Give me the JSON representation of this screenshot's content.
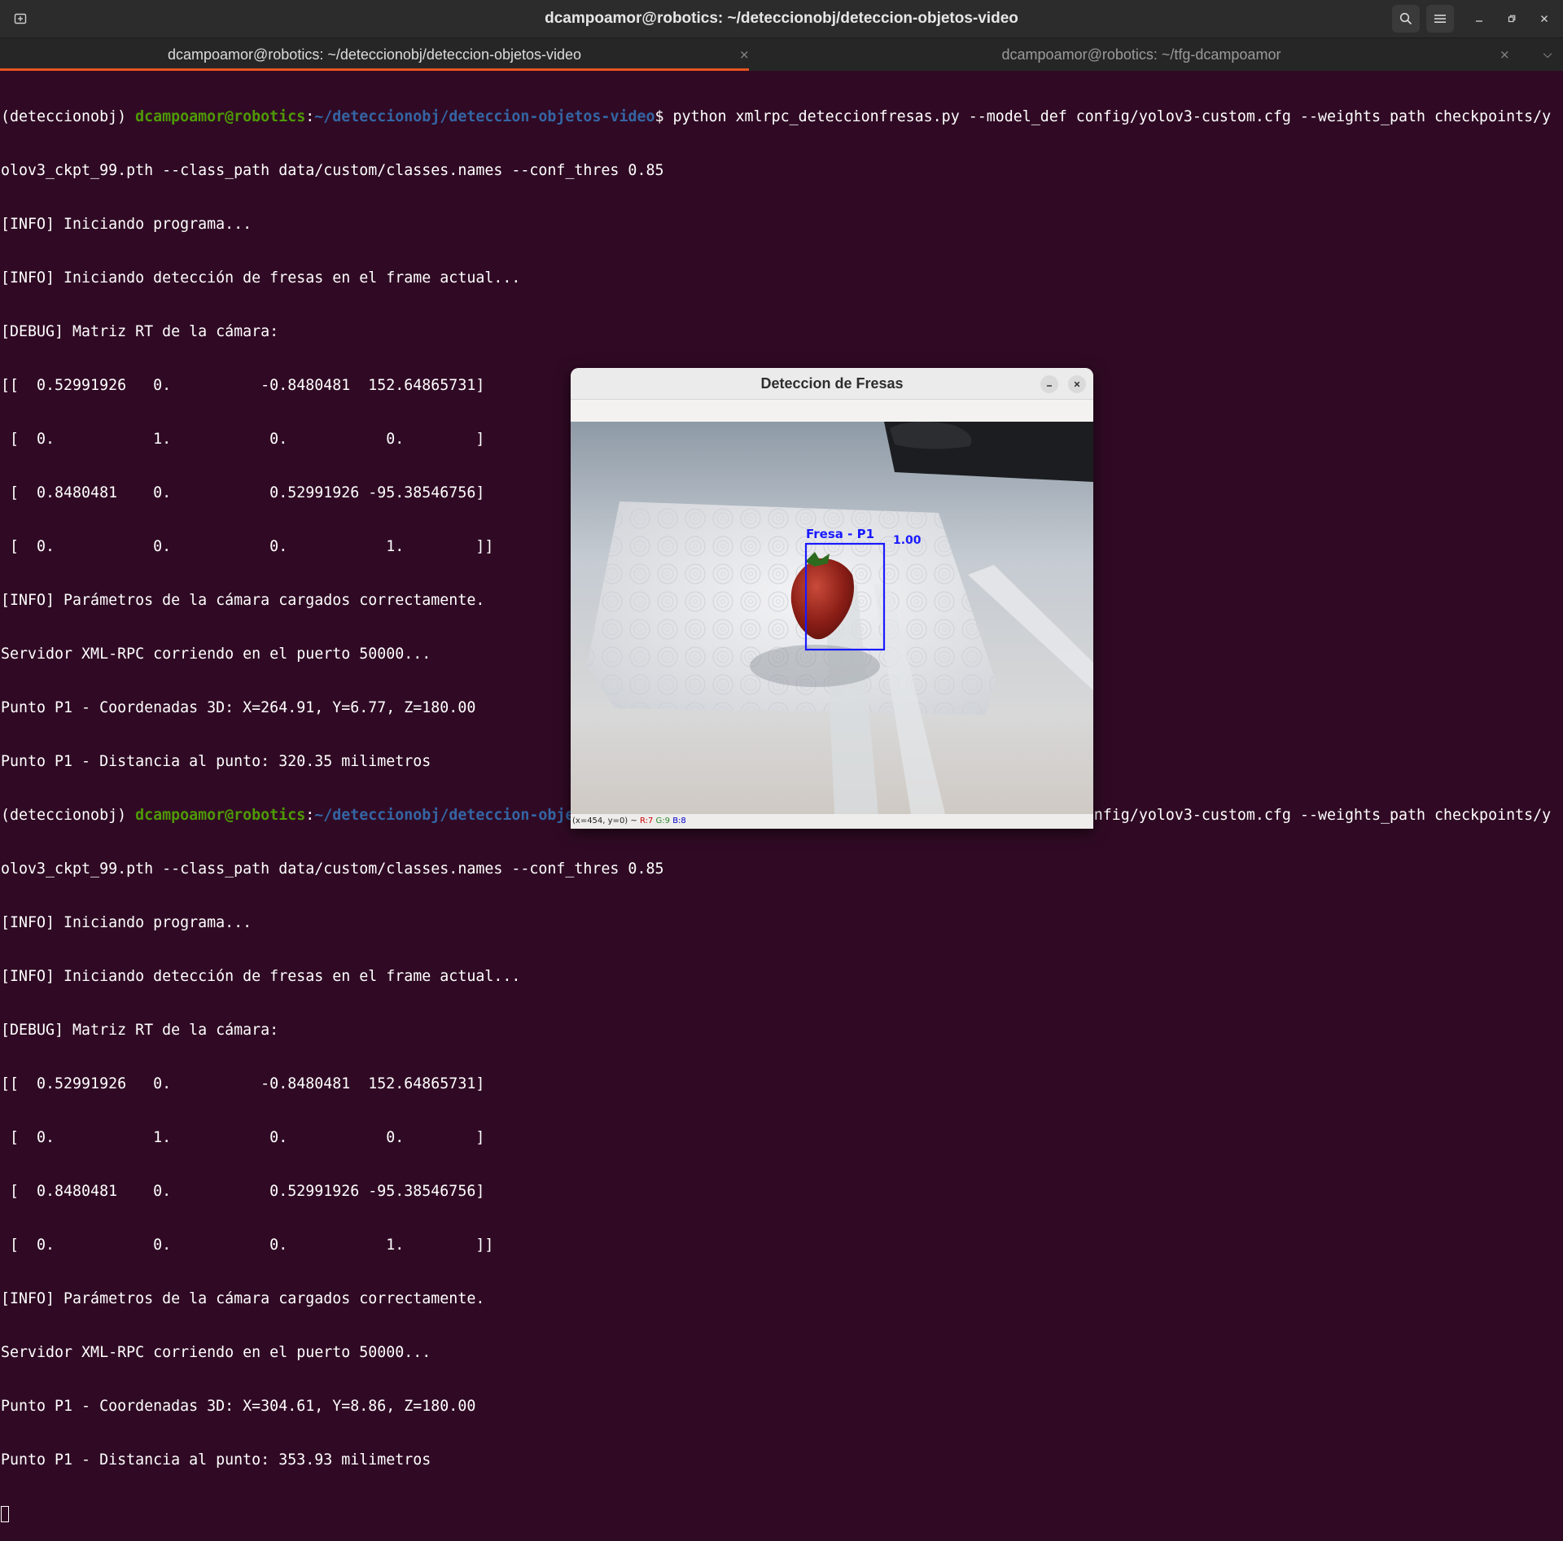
{
  "window": {
    "title": "dcampoamor@robotics: ~/deteccionobj/deteccion-objetos-video"
  },
  "tabs": [
    {
      "label": "dcampoamor@robotics: ~/deteccionobj/deteccion-objetos-video",
      "close": "×"
    },
    {
      "label": "dcampoamor@robotics: ~/tfg-dcampoamor",
      "close": "×"
    }
  ],
  "tab_menu": "⌵",
  "terminal": {
    "prompt_env": "(deteccionobj) ",
    "prompt_user": "dcampoamor@robotics",
    "prompt_sep": ":",
    "prompt_path": "~/deteccionobj/deteccion-objetos-video",
    "prompt_dollar": "$ ",
    "command_1": "python xmlrpc_deteccionfresas.py --model_def config/yolov3-custom.cfg --weights_path checkpoints/y",
    "command_2": "olov3_ckpt_99.pth --class_path data/custom/classes.names --conf_thres 0.85",
    "run1": [
      "[INFO] Iniciando programa...",
      "[INFO] Iniciando detección de fresas en el frame actual...",
      "[DEBUG] Matriz RT de la cámara:",
      "[[  0.52991926   0.          -0.8480481  152.64865731]",
      " [  0.           1.           0.           0.        ]",
      " [  0.8480481    0.           0.52991926 -95.38546756]",
      " [  0.           0.           0.           1.        ]]",
      "[INFO] Parámetros de la cámara cargados correctamente.",
      "Servidor XML-RPC corriendo en el puerto 50000...",
      "Punto P1 - Coordenadas 3D: X=264.91, Y=6.77, Z=180.00",
      "Punto P1 - Distancia al punto: 320.35 milimetros"
    ],
    "run2": [
      "[INFO] Iniciando programa...",
      "[INFO] Iniciando detección de fresas en el frame actual...",
      "[DEBUG] Matriz RT de la cámara:",
      "[[  0.52991926   0.          -0.8480481  152.64865731]",
      " [  0.           1.           0.           0.        ]",
      " [  0.8480481    0.           0.52991926 -95.38546756]",
      " [  0.           0.           0.           1.        ]]",
      "[INFO] Parámetros de la cámara cargados correctamente.",
      "Servidor XML-RPC corriendo en el puerto 50000...",
      "Punto P1 - Coordenadas 3D: X=304.61, Y=8.86, Z=180.00",
      "Punto P1 - Distancia al punto: 353.93 milimetros"
    ]
  },
  "dialog": {
    "title": "Deteccion de Fresas",
    "detection_label": "Fresa - P1",
    "detection_score": "1.00",
    "status_prefix": "(x=454, y=0) ~ ",
    "status_r": "R:7",
    "status_g": "G:9",
    "status_b": "B:8"
  },
  "colors": {
    "terminal_bg": "#300a24",
    "prompt_user": "#4e9a06",
    "prompt_path": "#3465a4",
    "tab_accent": "#e95420",
    "bbox": "#1a1aff"
  }
}
